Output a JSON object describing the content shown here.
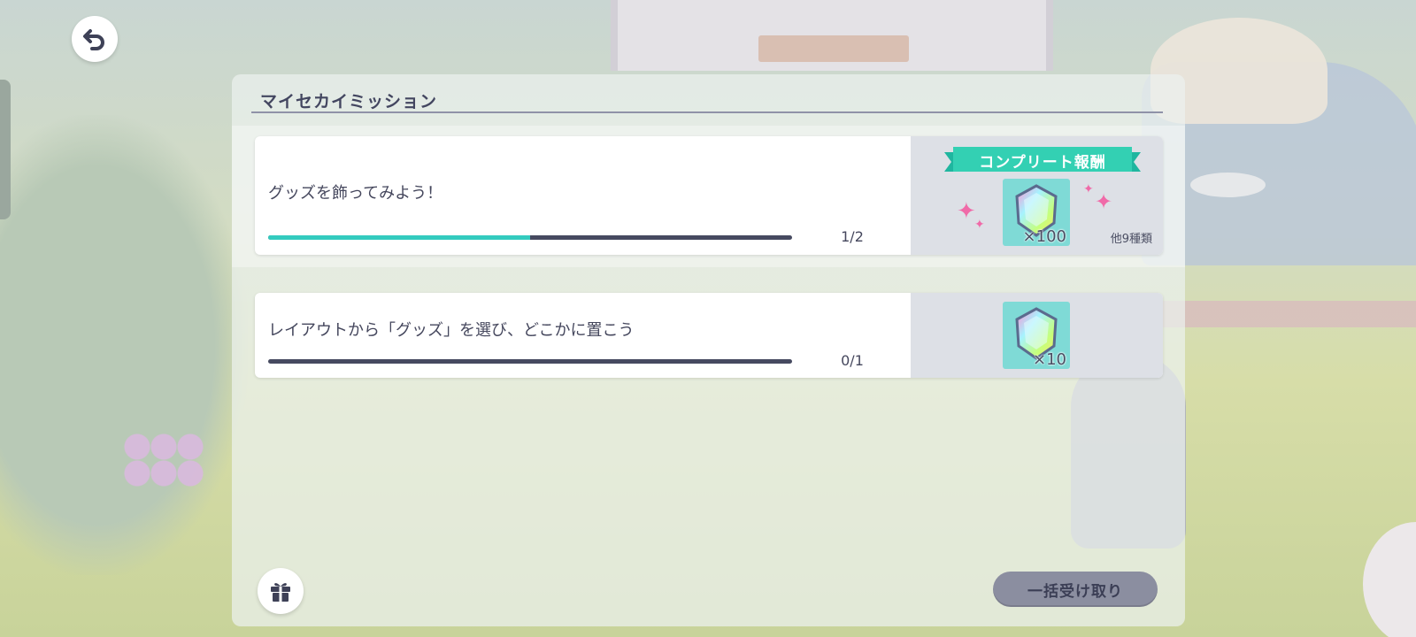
{
  "panel": {
    "title": "マイセカイミッション"
  },
  "missions": [
    {
      "text": "グッズを飾ってみよう！",
      "progress_text": "1/2",
      "progress_fraction": 0.5,
      "complete_banner": "コンプリート報酬",
      "reward_qty": "×100",
      "others": "他9種類",
      "reward_icon": "crystal-gem-icon"
    },
    {
      "text": "レイアウトから「グッズ」を選び、どこかに置こう",
      "progress_text": "0/1",
      "progress_fraction": 0,
      "reward_qty": "×10",
      "reward_icon": "crystal-gem-icon"
    }
  ],
  "footer": {
    "claim_all_label": "一括受け取り",
    "gift_icon": "gift-icon"
  },
  "header": {
    "back_icon": "back-arrow-icon"
  },
  "colors": {
    "accent": "#33cbbf",
    "track": "#464a60",
    "banner": "#33d0b3",
    "sparkle": "#f06aa8",
    "claim_button": "#8b8ea0"
  }
}
